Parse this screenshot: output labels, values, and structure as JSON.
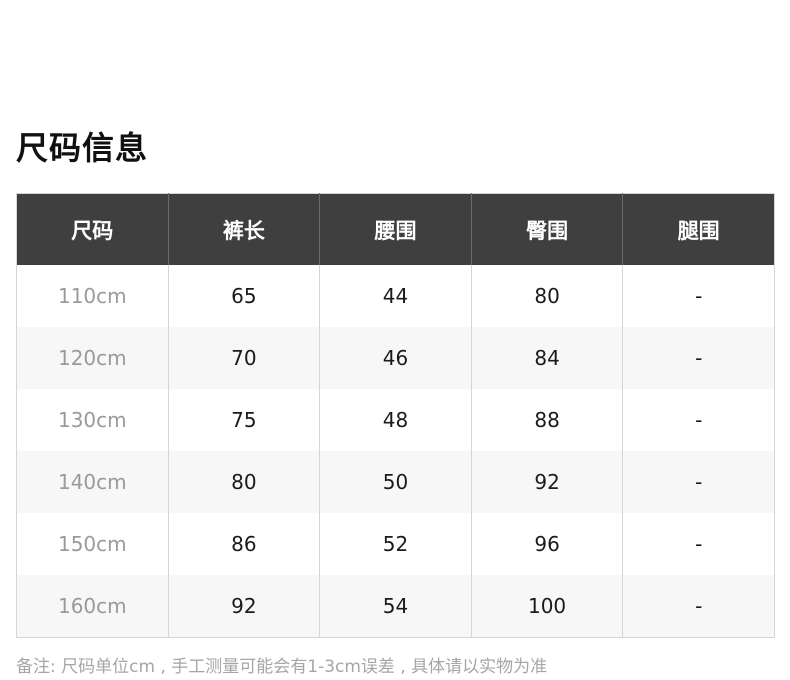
{
  "title": "尺码信息",
  "table": {
    "headers": [
      "尺码",
      "裤长",
      "腰围",
      "臀围",
      "腿围"
    ],
    "rows": [
      [
        "110cm",
        "65",
        "44",
        "80",
        "-"
      ],
      [
        "120cm",
        "70",
        "46",
        "84",
        "-"
      ],
      [
        "130cm",
        "75",
        "48",
        "88",
        "-"
      ],
      [
        "140cm",
        "80",
        "50",
        "92",
        "-"
      ],
      [
        "150cm",
        "86",
        "52",
        "96",
        "-"
      ],
      [
        "160cm",
        "92",
        "54",
        "100",
        "-"
      ]
    ]
  },
  "note": "备注: 尺码单位cm , 手工测量可能会有1-3cm误差 , 具体请以实物为准",
  "colors": {
    "header_bg": "#3f3f3f",
    "header_text": "#ffffff",
    "size_text": "#9a9a9a",
    "body_text": "#1a1a1a",
    "row_alt_bg": "#f7f7f7"
  }
}
